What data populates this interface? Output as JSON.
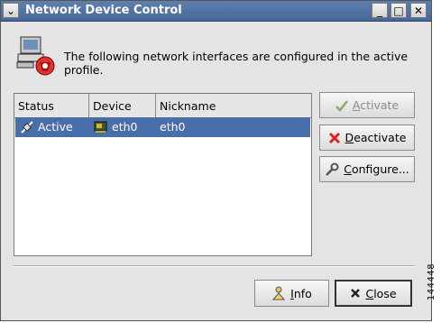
{
  "window": {
    "title": "Network Device Control"
  },
  "intro_text": "The following network interfaces are configured in the active profile.",
  "table": {
    "columns": [
      "Status",
      "Device",
      "Nickname"
    ],
    "rows": [
      {
        "status": "Active",
        "device": "eth0",
        "nickname": "eth0"
      }
    ]
  },
  "buttons": {
    "activate_access": "A",
    "activate_rest": "ctivate",
    "deactivate_access": "D",
    "deactivate_rest": "eactivate",
    "configure_access": "C",
    "configure_rest": "onfigure...",
    "info_access": "I",
    "info_rest": "nfo",
    "close_access": "C",
    "close_rest": "lose"
  },
  "figure_id": "144448",
  "colors": {
    "titlebar": "#5873a6",
    "selection": "#4a6ea9"
  }
}
